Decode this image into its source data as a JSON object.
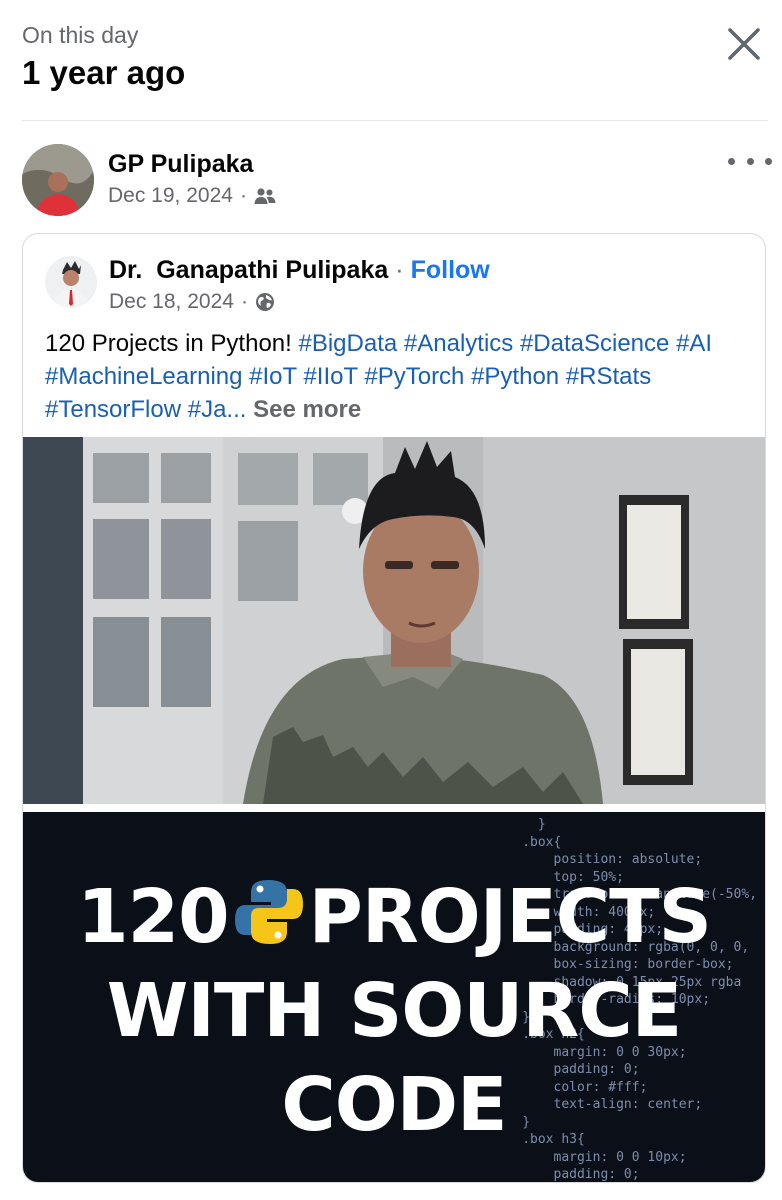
{
  "memory": {
    "subtitle": "On this day",
    "title": "1 year ago",
    "close_icon": "close-icon"
  },
  "post": {
    "author": "GP Pulipaka",
    "date": "Dec 19, 2024",
    "separator": "·",
    "audience_icon": "friends-icon",
    "more_icon": "more-options-icon"
  },
  "shared": {
    "author": "Dr.  Ganapathi Pulipaka",
    "separator": "·",
    "follow": "Follow",
    "date": "Dec 18, 2024",
    "audience_icon": "globe-icon",
    "text_intro": "120 Projects in Python! ",
    "hashtags": [
      "#BigData",
      "#Analytics",
      "#DataScience",
      "#AI",
      "#MachineLearning",
      "#IoT",
      "#IIoT",
      "#PyTorch",
      "#Python",
      "#RStats",
      "#TensorFlow"
    ],
    "truncated_tag": "#Ja...",
    "see_more": "See more"
  },
  "banner": {
    "line1_left": "120",
    "line1_right": "PROJECTS",
    "line2": "WITH SOURCE",
    "line3": "CODE"
  },
  "colors": {
    "link": "#1877f2",
    "hashtag": "#1a5fb4",
    "muted": "#65676b"
  }
}
